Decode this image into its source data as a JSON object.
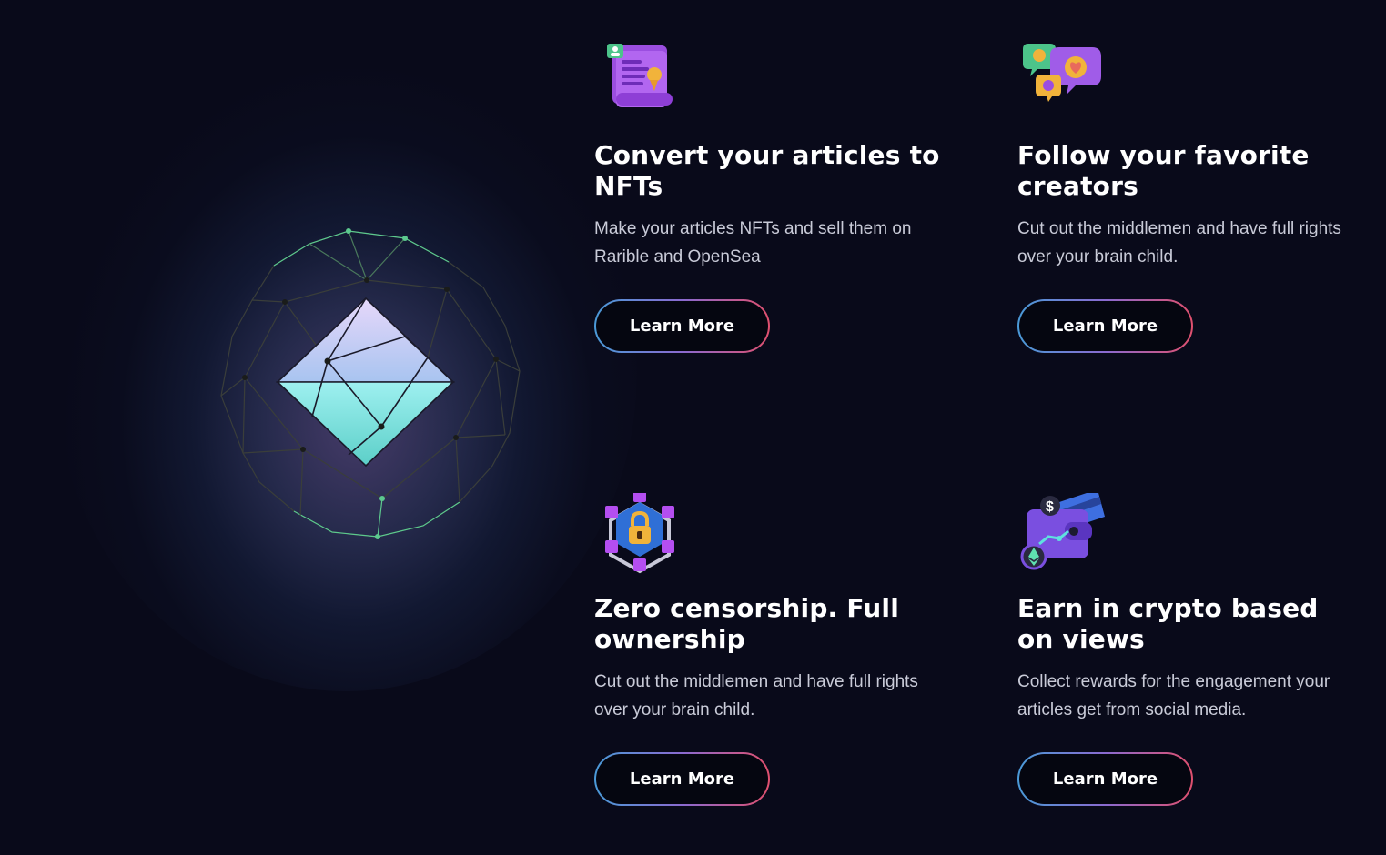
{
  "features": [
    {
      "title": "Convert your articles to NFTs",
      "description": "Make your articles NFTs and sell them on Rarible and OpenSea",
      "button_label": "Learn More",
      "icon": "certificate-scroll-icon"
    },
    {
      "title": "Follow your favorite creators",
      "description": "Cut out the middlemen and have full rights over your brain child.",
      "button_label": "Learn More",
      "icon": "chat-bubbles-icon"
    },
    {
      "title": "Zero censorship. Full ownership",
      "description": "Cut out the middlemen and have full rights over your brain child.",
      "button_label": "Learn More",
      "icon": "padlock-network-icon"
    },
    {
      "title": "Earn in crypto based on views",
      "description": "Collect rewards for the engagement your articles get from social media.",
      "button_label": "Learn More",
      "icon": "crypto-wallet-icon"
    }
  ],
  "hero": {
    "illustration": "diamond-in-wireframe-sphere"
  },
  "colors": {
    "background": "#090a1a",
    "button_gradient_start": "#4a9ad8",
    "button_gradient_mid": "#8a6ad0",
    "button_gradient_end": "#e0506e",
    "diamond_top": "#d4c4f6",
    "diamond_bottom": "#62d9d8",
    "wireframe_accent": "#5cc98e"
  }
}
